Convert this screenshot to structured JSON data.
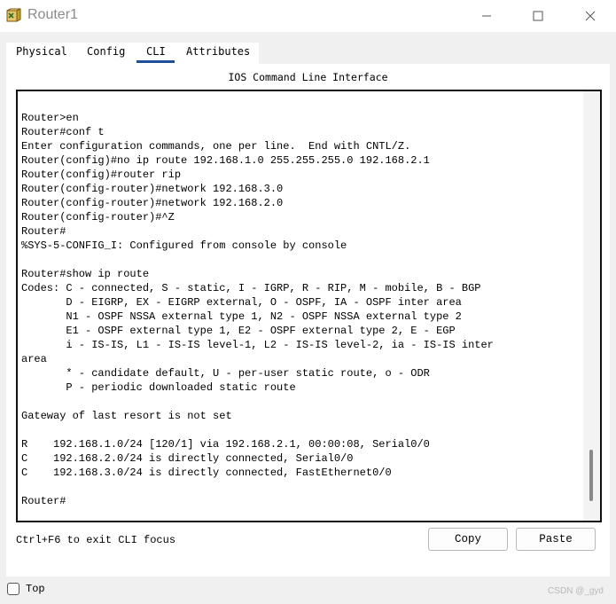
{
  "window": {
    "title": "Router1",
    "icon": "router-app-icon",
    "controls": [
      "minimize-icon",
      "maximize-icon",
      "close-icon"
    ]
  },
  "tabs": [
    {
      "label": "Physical",
      "active": false
    },
    {
      "label": "Config",
      "active": false
    },
    {
      "label": "CLI",
      "active": true
    },
    {
      "label": "Attributes",
      "active": false
    }
  ],
  "cli": {
    "title": "IOS Command Line Interface",
    "output": "\nRouter>en\nRouter#conf t\nEnter configuration commands, one per line.  End with CNTL/Z.\nRouter(config)#no ip route 192.168.1.0 255.255.255.0 192.168.2.1\nRouter(config)#router rip\nRouter(config-router)#network 192.168.3.0\nRouter(config-router)#network 192.168.2.0\nRouter(config-router)#^Z\nRouter#\n%SYS-5-CONFIG_I: Configured from console by console\n\nRouter#show ip route\nCodes: C - connected, S - static, I - IGRP, R - RIP, M - mobile, B - BGP\n       D - EIGRP, EX - EIGRP external, O - OSPF, IA - OSPF inter area\n       N1 - OSPF NSSA external type 1, N2 - OSPF NSSA external type 2\n       E1 - OSPF external type 1, E2 - OSPF external type 2, E - EGP\n       i - IS-IS, L1 - IS-IS level-1, L2 - IS-IS level-2, ia - IS-IS inter\narea\n       * - candidate default, U - per-user static route, o - ODR\n       P - periodic downloaded static route\n\nGateway of last resort is not set\n\nR    192.168.1.0/24 [120/1] via 192.168.2.1, 00:00:08, Serial0/0\nC    192.168.2.0/24 is directly connected, Serial0/0\nC    192.168.3.0/24 is directly connected, FastEthernet0/0\n\nRouter#",
    "hint": "Ctrl+F6 to exit CLI focus",
    "copy_label": "Copy",
    "paste_label": "Paste"
  },
  "footer": {
    "top_label": "Top",
    "top_checked": false,
    "watermark": "CSDN @_gyd"
  },
  "colors": {
    "active_tab_underline": "#1f4e9a",
    "window_bg": "#f0f0f0"
  }
}
